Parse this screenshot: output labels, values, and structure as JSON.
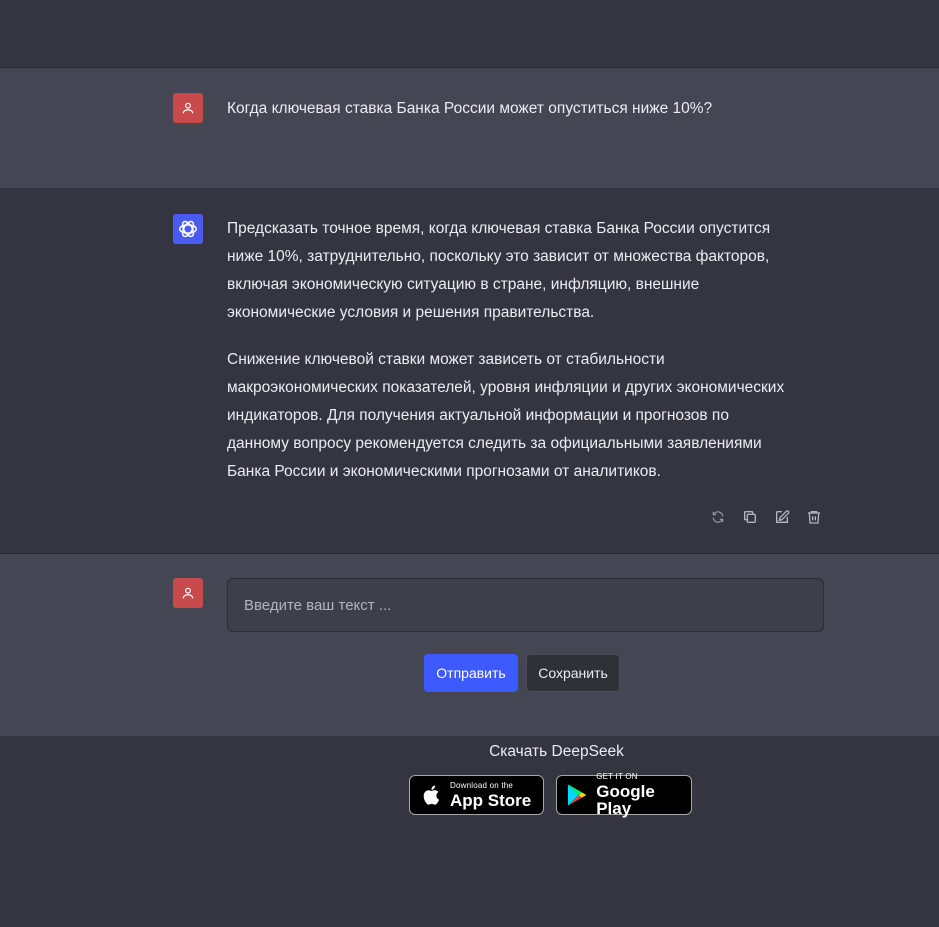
{
  "user_message": {
    "text": "Когда ключевая ставка Банка России может опуститься ниже 10%?"
  },
  "assistant_message": {
    "paragraphs": [
      "Предсказать точное время, когда ключевая ставка Банка России опустится ниже 10%, затруднительно, поскольку это зависит от множества факторов, включая экономическую ситуацию в стране, инфляцию, внешние экономические условия и решения правительства.",
      "Снижение ключевой ставки может зависеть от стабильности макроэкономических показателей, уровня инфляции и других экономических индикаторов. Для получения актуальной информации и прогнозов по данному вопросу рекомендуется следить за официальными заявлениями Банка России и экономическими прогнозами от аналитиков."
    ],
    "actions": [
      "refresh-icon",
      "copy-icon",
      "edit-icon",
      "trash-icon"
    ]
  },
  "composer": {
    "placeholder": "Введите ваш текст ...",
    "send_label": "Отправить",
    "save_label": "Сохранить"
  },
  "footer": {
    "download_title": "Скачать DeepSeek",
    "app_store": {
      "small": "Download on the",
      "big": "App Store"
    },
    "google_play": {
      "small": "GET IT ON",
      "big": "Google Play"
    }
  },
  "colors": {
    "user_avatar": "#c94a4a",
    "bot_avatar": "#4a5cf0",
    "send_button": "#3d5afe"
  }
}
